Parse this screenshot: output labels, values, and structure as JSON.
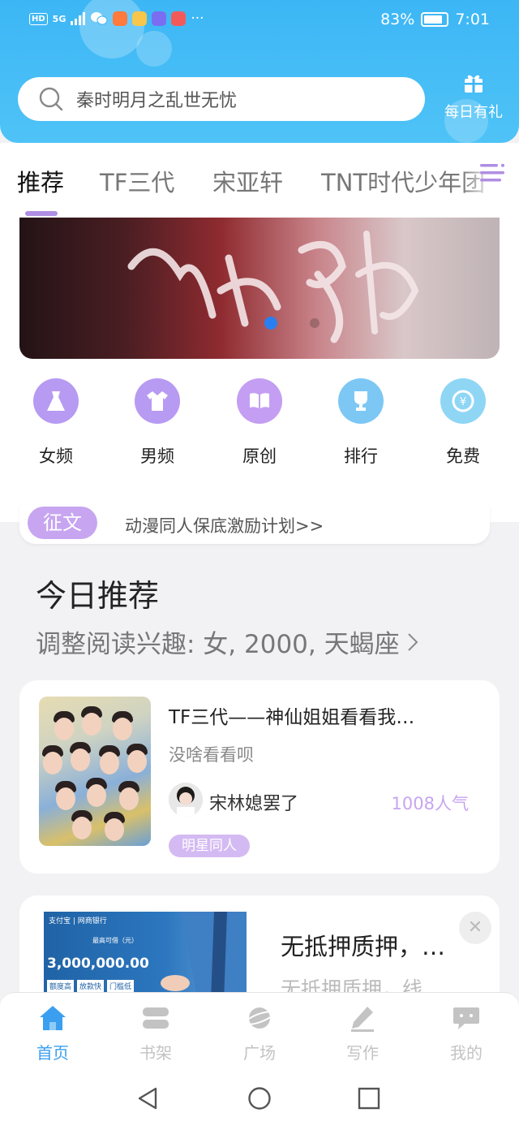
{
  "status_bar": {
    "hd": "HD",
    "signal": "5G",
    "more": "···",
    "battery": "83%",
    "time": "7:01"
  },
  "search": {
    "placeholder": "秦时明月之乱世无忧"
  },
  "daily_gift": {
    "label": "每日有礼"
  },
  "tabs": [
    {
      "label": "推荐"
    },
    {
      "label": "TF三代"
    },
    {
      "label": "宋亚轩"
    },
    {
      "label": "TNT时代少年团"
    }
  ],
  "categories": [
    {
      "label": "女频"
    },
    {
      "label": "男频"
    },
    {
      "label": "原创"
    },
    {
      "label": "排行"
    },
    {
      "label": "免费"
    }
  ],
  "notice": {
    "tag": "征文",
    "text": "动漫同人保底激励计划>>"
  },
  "today": {
    "title": "今日推荐",
    "subtitle": "调整阅读兴趣: 女, 2000, 天蝎座"
  },
  "book": {
    "title": "TF三代——神仙姐姐看看我…",
    "desc": "没啥看看呗",
    "author": "宋林媳罢了",
    "popularity": "1008人气",
    "tag": "明星同人"
  },
  "ad": {
    "title": "无抵押质押，…",
    "subtitle": "无抵押质押，线",
    "close": "✕",
    "img_brand": "支付宝 | 网商银行",
    "img_label": "最高可借（元）",
    "img_amount": "3,000,000.00",
    "img_badges": [
      "额度高",
      "放款快",
      "门槛低"
    ]
  },
  "bottom_nav": [
    {
      "label": "首页",
      "icon": "home-icon"
    },
    {
      "label": "书架",
      "icon": "bookshelf-icon"
    },
    {
      "label": "广场",
      "icon": "planet-icon"
    },
    {
      "label": "写作",
      "icon": "pen-icon"
    },
    {
      "label": "我的",
      "icon": "chat-icon"
    }
  ],
  "colors": {
    "header": "#3cb6f5",
    "accent_purple": "#c7a5f0",
    "nav_active": "#3a9ff0"
  }
}
